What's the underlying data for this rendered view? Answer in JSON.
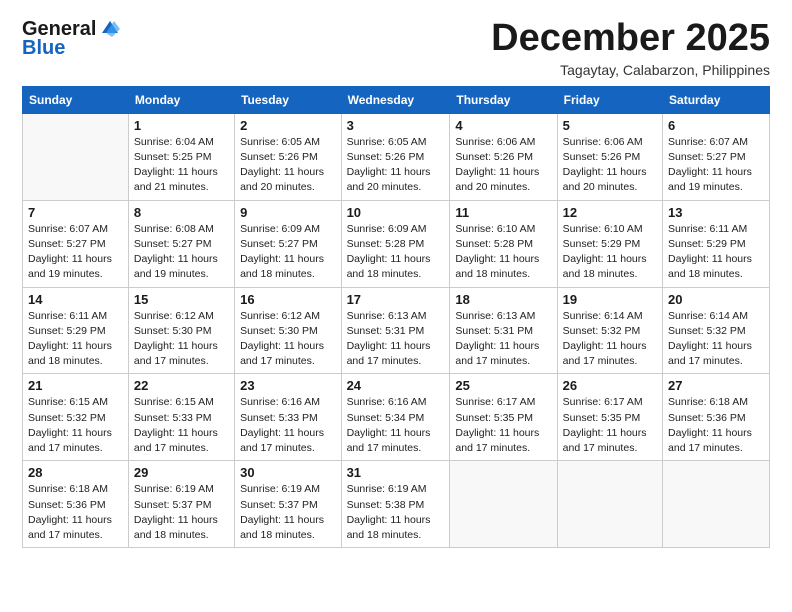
{
  "logo": {
    "line1": "General",
    "line2": "Blue"
  },
  "header": {
    "month": "December 2025",
    "location": "Tagaytay, Calabarzon, Philippines"
  },
  "weekdays": [
    "Sunday",
    "Monday",
    "Tuesday",
    "Wednesday",
    "Thursday",
    "Friday",
    "Saturday"
  ],
  "weeks": [
    [
      {
        "day": "",
        "info": ""
      },
      {
        "day": "1",
        "info": "Sunrise: 6:04 AM\nSunset: 5:25 PM\nDaylight: 11 hours\nand 21 minutes."
      },
      {
        "day": "2",
        "info": "Sunrise: 6:05 AM\nSunset: 5:26 PM\nDaylight: 11 hours\nand 20 minutes."
      },
      {
        "day": "3",
        "info": "Sunrise: 6:05 AM\nSunset: 5:26 PM\nDaylight: 11 hours\nand 20 minutes."
      },
      {
        "day": "4",
        "info": "Sunrise: 6:06 AM\nSunset: 5:26 PM\nDaylight: 11 hours\nand 20 minutes."
      },
      {
        "day": "5",
        "info": "Sunrise: 6:06 AM\nSunset: 5:26 PM\nDaylight: 11 hours\nand 20 minutes."
      },
      {
        "day": "6",
        "info": "Sunrise: 6:07 AM\nSunset: 5:27 PM\nDaylight: 11 hours\nand 19 minutes."
      }
    ],
    [
      {
        "day": "7",
        "info": "Sunrise: 6:07 AM\nSunset: 5:27 PM\nDaylight: 11 hours\nand 19 minutes."
      },
      {
        "day": "8",
        "info": "Sunrise: 6:08 AM\nSunset: 5:27 PM\nDaylight: 11 hours\nand 19 minutes."
      },
      {
        "day": "9",
        "info": "Sunrise: 6:09 AM\nSunset: 5:27 PM\nDaylight: 11 hours\nand 18 minutes."
      },
      {
        "day": "10",
        "info": "Sunrise: 6:09 AM\nSunset: 5:28 PM\nDaylight: 11 hours\nand 18 minutes."
      },
      {
        "day": "11",
        "info": "Sunrise: 6:10 AM\nSunset: 5:28 PM\nDaylight: 11 hours\nand 18 minutes."
      },
      {
        "day": "12",
        "info": "Sunrise: 6:10 AM\nSunset: 5:29 PM\nDaylight: 11 hours\nand 18 minutes."
      },
      {
        "day": "13",
        "info": "Sunrise: 6:11 AM\nSunset: 5:29 PM\nDaylight: 11 hours\nand 18 minutes."
      }
    ],
    [
      {
        "day": "14",
        "info": "Sunrise: 6:11 AM\nSunset: 5:29 PM\nDaylight: 11 hours\nand 18 minutes."
      },
      {
        "day": "15",
        "info": "Sunrise: 6:12 AM\nSunset: 5:30 PM\nDaylight: 11 hours\nand 17 minutes."
      },
      {
        "day": "16",
        "info": "Sunrise: 6:12 AM\nSunset: 5:30 PM\nDaylight: 11 hours\nand 17 minutes."
      },
      {
        "day": "17",
        "info": "Sunrise: 6:13 AM\nSunset: 5:31 PM\nDaylight: 11 hours\nand 17 minutes."
      },
      {
        "day": "18",
        "info": "Sunrise: 6:13 AM\nSunset: 5:31 PM\nDaylight: 11 hours\nand 17 minutes."
      },
      {
        "day": "19",
        "info": "Sunrise: 6:14 AM\nSunset: 5:32 PM\nDaylight: 11 hours\nand 17 minutes."
      },
      {
        "day": "20",
        "info": "Sunrise: 6:14 AM\nSunset: 5:32 PM\nDaylight: 11 hours\nand 17 minutes."
      }
    ],
    [
      {
        "day": "21",
        "info": "Sunrise: 6:15 AM\nSunset: 5:32 PM\nDaylight: 11 hours\nand 17 minutes."
      },
      {
        "day": "22",
        "info": "Sunrise: 6:15 AM\nSunset: 5:33 PM\nDaylight: 11 hours\nand 17 minutes."
      },
      {
        "day": "23",
        "info": "Sunrise: 6:16 AM\nSunset: 5:33 PM\nDaylight: 11 hours\nand 17 minutes."
      },
      {
        "day": "24",
        "info": "Sunrise: 6:16 AM\nSunset: 5:34 PM\nDaylight: 11 hours\nand 17 minutes."
      },
      {
        "day": "25",
        "info": "Sunrise: 6:17 AM\nSunset: 5:35 PM\nDaylight: 11 hours\nand 17 minutes."
      },
      {
        "day": "26",
        "info": "Sunrise: 6:17 AM\nSunset: 5:35 PM\nDaylight: 11 hours\nand 17 minutes."
      },
      {
        "day": "27",
        "info": "Sunrise: 6:18 AM\nSunset: 5:36 PM\nDaylight: 11 hours\nand 17 minutes."
      }
    ],
    [
      {
        "day": "28",
        "info": "Sunrise: 6:18 AM\nSunset: 5:36 PM\nDaylight: 11 hours\nand 17 minutes."
      },
      {
        "day": "29",
        "info": "Sunrise: 6:19 AM\nSunset: 5:37 PM\nDaylight: 11 hours\nand 18 minutes."
      },
      {
        "day": "30",
        "info": "Sunrise: 6:19 AM\nSunset: 5:37 PM\nDaylight: 11 hours\nand 18 minutes."
      },
      {
        "day": "31",
        "info": "Sunrise: 6:19 AM\nSunset: 5:38 PM\nDaylight: 11 hours\nand 18 minutes."
      },
      {
        "day": "",
        "info": ""
      },
      {
        "day": "",
        "info": ""
      },
      {
        "day": "",
        "info": ""
      }
    ]
  ]
}
